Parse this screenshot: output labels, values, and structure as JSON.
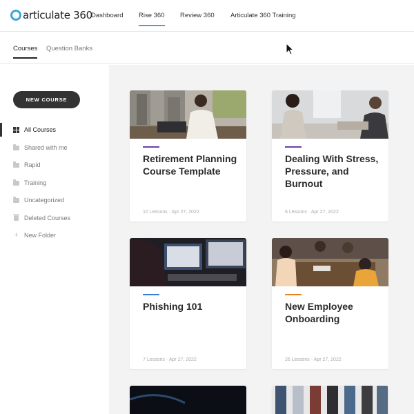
{
  "app": {
    "logo_text": "articulate 360",
    "nav": [
      {
        "label": "Dashboard"
      },
      {
        "label": "Rise 360"
      },
      {
        "label": "Review 360"
      },
      {
        "label": "Articulate 360 Training"
      }
    ],
    "active_nav": "Rise 360",
    "accent_color": "#3aa6e0"
  },
  "subnav": {
    "tabs": [
      {
        "label": "Courses"
      },
      {
        "label": "Question Banks"
      }
    ],
    "active_tab": "Courses"
  },
  "sidebar": {
    "new_course_label": "NEW COURSE",
    "items": [
      {
        "label": "All Courses",
        "icon": "grid-icon"
      },
      {
        "label": "Shared with me",
        "icon": "shared-folder-icon"
      },
      {
        "label": "Rapid",
        "icon": "folder-icon"
      },
      {
        "label": "Training",
        "icon": "folder-icon"
      },
      {
        "label": "Uncategorized",
        "icon": "folder-icon"
      },
      {
        "label": "Deleted Courses",
        "icon": "trash-icon"
      },
      {
        "label": "New Folder",
        "icon": "plus-icon"
      }
    ],
    "active_item": "All Courses"
  },
  "courses": [
    {
      "title": "Retirement Planning Course Template",
      "meta": "10 Lessons · Apr 27, 2022",
      "accent": "#6b3fa0"
    },
    {
      "title": "Dealing With Stress, Pressure, and Burnout",
      "meta": "6 Lessons · Apr 27, 2022",
      "accent": "#6b3fa0"
    },
    {
      "title": "Phishing 101",
      "meta": "7 Lessons · Apr 27, 2022",
      "accent": "#3a7bd5"
    },
    {
      "title": "New Employee Onboarding",
      "meta": "26 Lessons · Apr 27, 2022",
      "accent": "#f07f22"
    }
  ]
}
